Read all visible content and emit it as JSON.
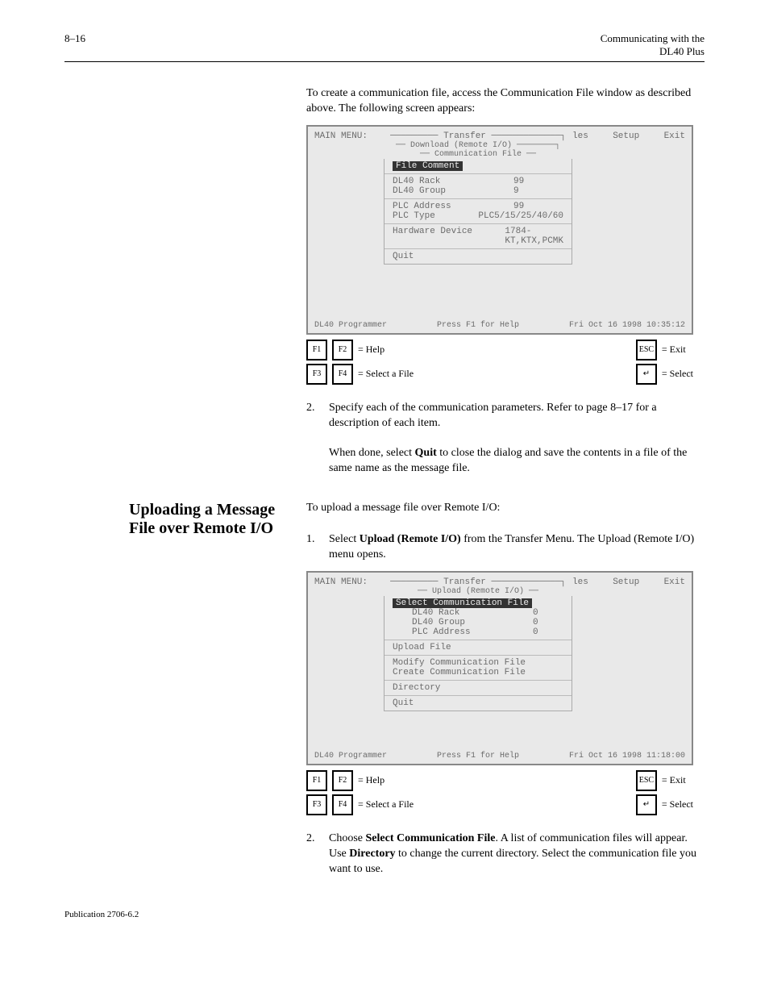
{
  "header": {
    "chapter_num": "8–16",
    "chapter_title_line1": "Communicating with the",
    "chapter_title_line2": "DL40 Plus"
  },
  "intro_para": "To create a communication file, access the Communication File window as described above. The following screen appears:",
  "screenshot1": {
    "menubar_left": "MAIN MENU:",
    "menubar_center": "───────── Transfer ─────────────┐",
    "menubar_right_a": "les",
    "menubar_right_b": "Setup",
    "menubar_right_c": "Exit",
    "subline": "── Download (Remote I/O) ────────┐",
    "boxtitle": "── Communication File ──",
    "sel": "File Comment",
    "rows": [
      {
        "k": "DL40 Rack",
        "v": "99"
      },
      {
        "k": "DL40 Group",
        "v": "9"
      },
      {
        "k": "PLC Address",
        "v": "99"
      },
      {
        "k": "PLC Type",
        "v": "PLC5/15/25/40/60"
      },
      {
        "k": "Hardware Device",
        "v": "1784-KT,KTX,PCMK"
      },
      {
        "k": "Quit",
        "v": ""
      }
    ],
    "status_left": "DL40 Programmer",
    "status_mid": "Press F1 for Help",
    "status_right": "Fri Oct 16 1998 10:35:12"
  },
  "kb": {
    "f1": "F1",
    "f2": "F2",
    "f3": "F3",
    "f4": "F4",
    "f1_label": "= Help",
    "f3_label": "= Select a File",
    "esc": "ESC",
    "esc_label": "= Exit",
    "enter": "↵",
    "enter_label": "= Select"
  },
  "step2": {
    "num": "2.",
    "text_a": "Specify each of the communication parameters. Refer to page 8–17 for a description of each item.",
    "text_b": "When done, select ",
    "quit": "Quit",
    "text_c": " to close the dialog and save the contents in a file of the same name as the message file."
  },
  "section2": {
    "side_heading": "Uploading a Message File over Remote I/O",
    "intro": "To upload a message file over Remote I/O:",
    "step1_num": "1.",
    "step1_text_a": "Select ",
    "step1_upload": "Upload (Remote I/O)",
    "step1_text_b": " from the Transfer Menu. The Upload (Remote I/O) menu opens."
  },
  "screenshot2": {
    "menubar_left": "MAIN MENU:",
    "menubar_center": "───────── Transfer ─────────────┐",
    "menubar_right_a": "les",
    "menubar_right_b": "Setup",
    "menubar_right_c": "Exit",
    "subline": "── Upload (Remote I/O) ──",
    "sel": "Select Communication File",
    "rows_inline": [
      {
        "k": "DL40 Rack",
        "v": "0"
      },
      {
        "k": "DL40 Group",
        "v": "0"
      },
      {
        "k": "PLC Address",
        "v": "0"
      }
    ],
    "rows": [
      {
        "k": "Upload File",
        "v": ""
      },
      {
        "k": "Modify Communication File",
        "v": ""
      },
      {
        "k": "Create Communication File",
        "v": ""
      },
      {
        "k": "Directory",
        "v": ""
      },
      {
        "k": "Quit",
        "v": ""
      }
    ],
    "status_left": "DL40 Programmer",
    "status_mid": "Press F1 for Help",
    "status_right": "Fri Oct 16 1998 11:18:00"
  },
  "section2_step2": {
    "num": "2.",
    "text_a": "Choose ",
    "sel": "Select Communication File",
    "text_b": ". A list of communication files will appear. Use ",
    "dir": "Directory",
    "text_c": " to change the current directory. Select the communication file you want to use."
  },
  "footer": {
    "pub": "Publication 2706-6.2"
  }
}
